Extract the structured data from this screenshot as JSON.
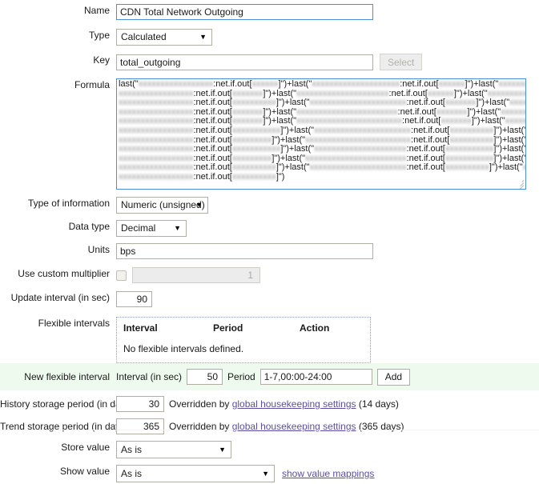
{
  "form": {
    "name": {
      "label": "Name",
      "value": "CDN Total Network Outgoing"
    },
    "type": {
      "label": "Type",
      "value": "Calculated",
      "arrow": "▼"
    },
    "key": {
      "label": "Key",
      "value": "total_outgoing",
      "select_button": "Select"
    },
    "formula": {
      "label": "Formula",
      "lines": [
        "last(\"xxxxxxxxxxxxxxxxx:net.if.out[xxxxxx]\")+last(\"xxxxxxxxxxxxxxxxxxxx:net.if.out[xxxxxx]\")+last(\"xxxxxxxxxxxxx",
        "xxxxxxxxxxxxxxxxx:net.if.out[xxxxxxx]\")+last(\"xxxxxxxxxxxxxxxxxxxxx:net.if.out[xxxxxx]\")+last(\"xxxxxxxxxxxxxx",
        "xxxxxxxxxxxxxxxxx:net.if.out[xxxxxxxxxx]\")+last(\"xxxxxxxxxxxxxxxxxxxxxx:net.if.out[xxxxxxx]\")+last(\"xxxxxxxxx",
        "xxxxxxxxxxxxxxxxx:net.if.out[xxxxxxx]\")+last(\"xxxxxxxxxxxxxxxxxxxxxxx:net.if.out[xxxxxxx]\")+last(\"xxxxxxxxxxx",
        "xxxxxxxxxxxxxxxxx:net.if.out[xxxxxxx]\")+last(\"xxxxxxxxxxxxxxxxxxxxxxxx:net.if.out[xxxxxxx]\")+last(\"xxxxxxxxxx",
        "xxxxxxxxxxxxxxxxx:net.if.out[xxxxxxxxxxx]\")+last(\"xxxxxxxxxxxxxxxxxxxxxx:net.if.out[xxxxxxxxxx]\")+last(\"xxxxxx",
        "xxxxxxxxxxxxxxxxx:net.if.out[xxxxxxxxx]\")+last(\"xxxxxxxxxxxxxxxxxxxxxxxx:net.if.out[xxxxxxxxxx]\")+last(\"xxxxxx",
        "xxxxxxxxxxxxxxxxx:net.if.out[xxxxxxxxxxx]\")+last(\"xxxxxxxxxxxxxxxxxxxxx:net.if.out[xxxxxxxxxxx]\")+last(\"xxxxxx",
        "xxxxxxxxxxxxxxxxx:net.if.out[xxxxxxxxx]\")+last(\"xxxxxxxxxxxxxxxxxxxxxxx:net.if.out[xxxxxxxxxxx]\")+last(\"xxxxxx",
        "xxxxxxxxxxxxxxxxx:net.if.out[xxxxxxxxxx]\")+last(\"xxxxxxxxxxxxxxxxxxxxxx:net.if.out[xxxxxxxxxx]\")+last(\"xxxxxxx",
        "xxxxxxxxxxxxxxxxx:net.if.out[xxxxxxxxxx]\")"
      ]
    },
    "type_of_information": {
      "label": "Type of information",
      "value": "Numeric (unsigned)",
      "arrow": "▼"
    },
    "data_type": {
      "label": "Data type",
      "value": "Decimal",
      "arrow": "▼"
    },
    "units": {
      "label": "Units",
      "value": "bps"
    },
    "custom_multiplier": {
      "label": "Use custom multiplier",
      "checked": false,
      "value": "1"
    },
    "update_interval": {
      "label": "Update interval (in sec)",
      "value": "90"
    },
    "flexible_intervals": {
      "label": "Flexible intervals",
      "columns": [
        "Interval",
        "Period",
        "Action"
      ],
      "empty_text": "No flexible intervals defined."
    },
    "new_flexible_interval": {
      "label": "New flexible interval",
      "interval_label": "Interval (in sec)",
      "interval_value": "50",
      "period_label": "Period",
      "period_value": "1-7,00:00-24:00",
      "add_button": "Add"
    },
    "history_storage": {
      "label": "History storage period (in days)",
      "value": "30",
      "note_prefix": "Overridden by",
      "note_link": "global housekeeping settings",
      "note_suffix": "(14 days)"
    },
    "trend_storage": {
      "label": "Trend storage period (in days)",
      "value": "365",
      "note_prefix": "Overridden by",
      "note_link": "global housekeeping settings",
      "note_suffix": "(365 days)"
    },
    "store_value": {
      "label": "Store value",
      "value": "As is",
      "arrow": "▼"
    },
    "show_value": {
      "label": "Show value",
      "value": "As is",
      "arrow": "▼",
      "mappings_link": "show value mappings"
    }
  },
  "colors": {
    "focus_border": "#4a90d9",
    "input_border": "#b0aea2",
    "highlight_row": "#eefaee",
    "link": "#5c4fa0"
  }
}
